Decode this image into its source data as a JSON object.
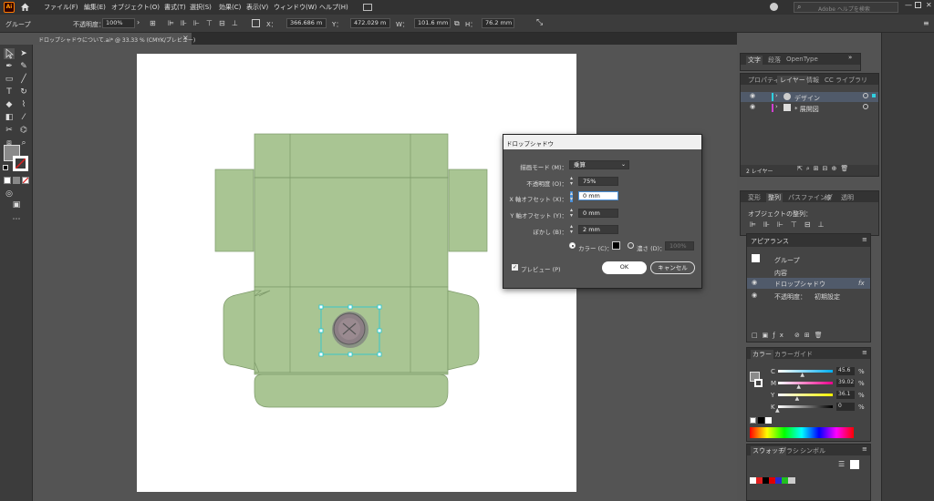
{
  "app": {
    "logo": "Ai"
  },
  "menu": [
    "ファイル(F)",
    "編集(E)",
    "オブジェクト(O)",
    "書式(T)",
    "選択(S)",
    "効果(C)",
    "表示(V)",
    "ウィンドウ(W)",
    "ヘルプ(H)"
  ],
  "search": {
    "placeholder": "Adobe ヘルプを検索"
  },
  "control": {
    "selection": "グループ",
    "opacity_label": "不透明度：",
    "opacity_value": "100%",
    "x_label": "X：",
    "x_value": "366.686 m",
    "y_label": "Y：",
    "y_value": "472.029 m",
    "w_label": "W：",
    "w_value": "101.6 mm",
    "h_label": "H：",
    "h_value": "76.2 mm"
  },
  "document": {
    "tab": "ドロップシャドウについて.ai* @ 33.33 % (CMYK/プレビュー)"
  },
  "dialog": {
    "title": "ドロップシャドウ",
    "mode_label": "描画モード (M)：",
    "mode_value": "乗算",
    "opacity_label": "不透明度 (O)：",
    "opacity_value": "75%",
    "x_label": "X 軸オフセット (X)：",
    "x_value": "0 mm",
    "y_label": "Y 軸オフセット (Y)：",
    "y_value": "0 mm",
    "blur_label": "ぼかし (B)：",
    "blur_value": "2 mm",
    "color_label": "カラー (C)：",
    "dark_label": "濃さ (D)：",
    "dark_value": "100%",
    "preview_label": "プレビュー (P)",
    "ok": "OK",
    "cancel": "キャンセル"
  },
  "panel_char": {
    "tabs": [
      "文字",
      "段落",
      "OpenType"
    ]
  },
  "panel_layers": {
    "tabs": [
      "プロパティ",
      "レイヤー",
      "情報",
      "CC ライブラリ"
    ],
    "layers": [
      "デザイン",
      "* 展開図"
    ],
    "count": "2 レイヤー"
  },
  "panel_transform": {
    "tabs": [
      "変形",
      "整列",
      "パスファインダ",
      "線",
      "透明"
    ],
    "label": "オブジェクトの整列："
  },
  "panel_appearance": {
    "title": "アピアランス",
    "group": "グループ",
    "content": "内容",
    "effect": "ドロップシャドウ",
    "fx": "fx",
    "opacity_label": "不透明度：",
    "opacity_value": "初期設定"
  },
  "panel_color": {
    "tabs": [
      "カラー",
      "カラーガイド"
    ],
    "channels": [
      {
        "label": "C",
        "value": "45.6",
        "unit": "%"
      },
      {
        "label": "M",
        "value": "39.02",
        "unit": "%"
      },
      {
        "label": "Y",
        "value": "36.1",
        "unit": "%"
      },
      {
        "label": "K",
        "value": "0",
        "unit": "%"
      }
    ],
    "colors": {
      "accent": "#4a90d9",
      "box": "#a9c593",
      "shadow": "#8a8a8a"
    }
  },
  "panel_swatch": {
    "tabs": [
      "スウォッチ",
      "ブラシ",
      "シンボル"
    ]
  }
}
